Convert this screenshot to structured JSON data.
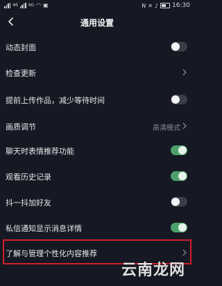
{
  "status_bar": {
    "left": "46",
    "network": "4G",
    "time": "16:30"
  },
  "header": {
    "title": "通用设置"
  },
  "settings": [
    {
      "label": "动态封面",
      "control": "toggle",
      "on": false
    },
    {
      "label": "检查更新",
      "control": "chevron"
    },
    {
      "label": "提前上传作品，减少等待时间",
      "control": "toggle",
      "on": false
    },
    {
      "label": "画质调节",
      "control": "value",
      "value": "高清模式"
    },
    {
      "label": "聊天时表情推荐功能",
      "control": "toggle",
      "on": true
    },
    {
      "label": "观看历史记录",
      "control": "toggle",
      "on": true
    },
    {
      "label": "抖一抖加好友",
      "control": "toggle",
      "on": false
    },
    {
      "label": "私信通知显示消息详情",
      "control": "toggle",
      "on": true
    },
    {
      "label": "了解与管理个性化内容推荐",
      "control": "chevron"
    }
  ],
  "watermark": "云南龙网",
  "colors": {
    "background": "#161823",
    "toggle_on": "#4da26b",
    "toggle_off": "#3b3d47",
    "highlight_border": "#d21f2a"
  }
}
